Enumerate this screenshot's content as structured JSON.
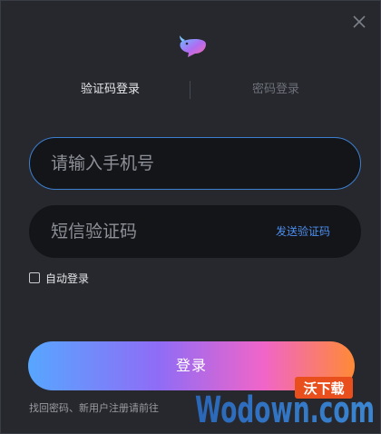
{
  "tabs": {
    "active_label": "验证码登录",
    "inactive_label": "密码登录"
  },
  "phone": {
    "placeholder": "请输入手机号",
    "value": ""
  },
  "code": {
    "placeholder": "短信验证码",
    "value": "",
    "send_label": "发送验证码"
  },
  "auto_login": {
    "label": "自动登录",
    "checked": false
  },
  "login_button": {
    "label": "登录"
  },
  "footer": {
    "text": "找回密码、新用户注册请前往"
  },
  "watermark": {
    "text": "Wodown.com",
    "badge": "沃下载"
  },
  "colors": {
    "background": "#26282d",
    "field_background": "#141518",
    "accent_blue": "#4c8ff0",
    "gradient": [
      "#57a6ff",
      "#8f6cf6",
      "#f065c9",
      "#ff8a36"
    ]
  },
  "icons": {
    "close": "close-icon",
    "logo": "app-logo-icon"
  }
}
